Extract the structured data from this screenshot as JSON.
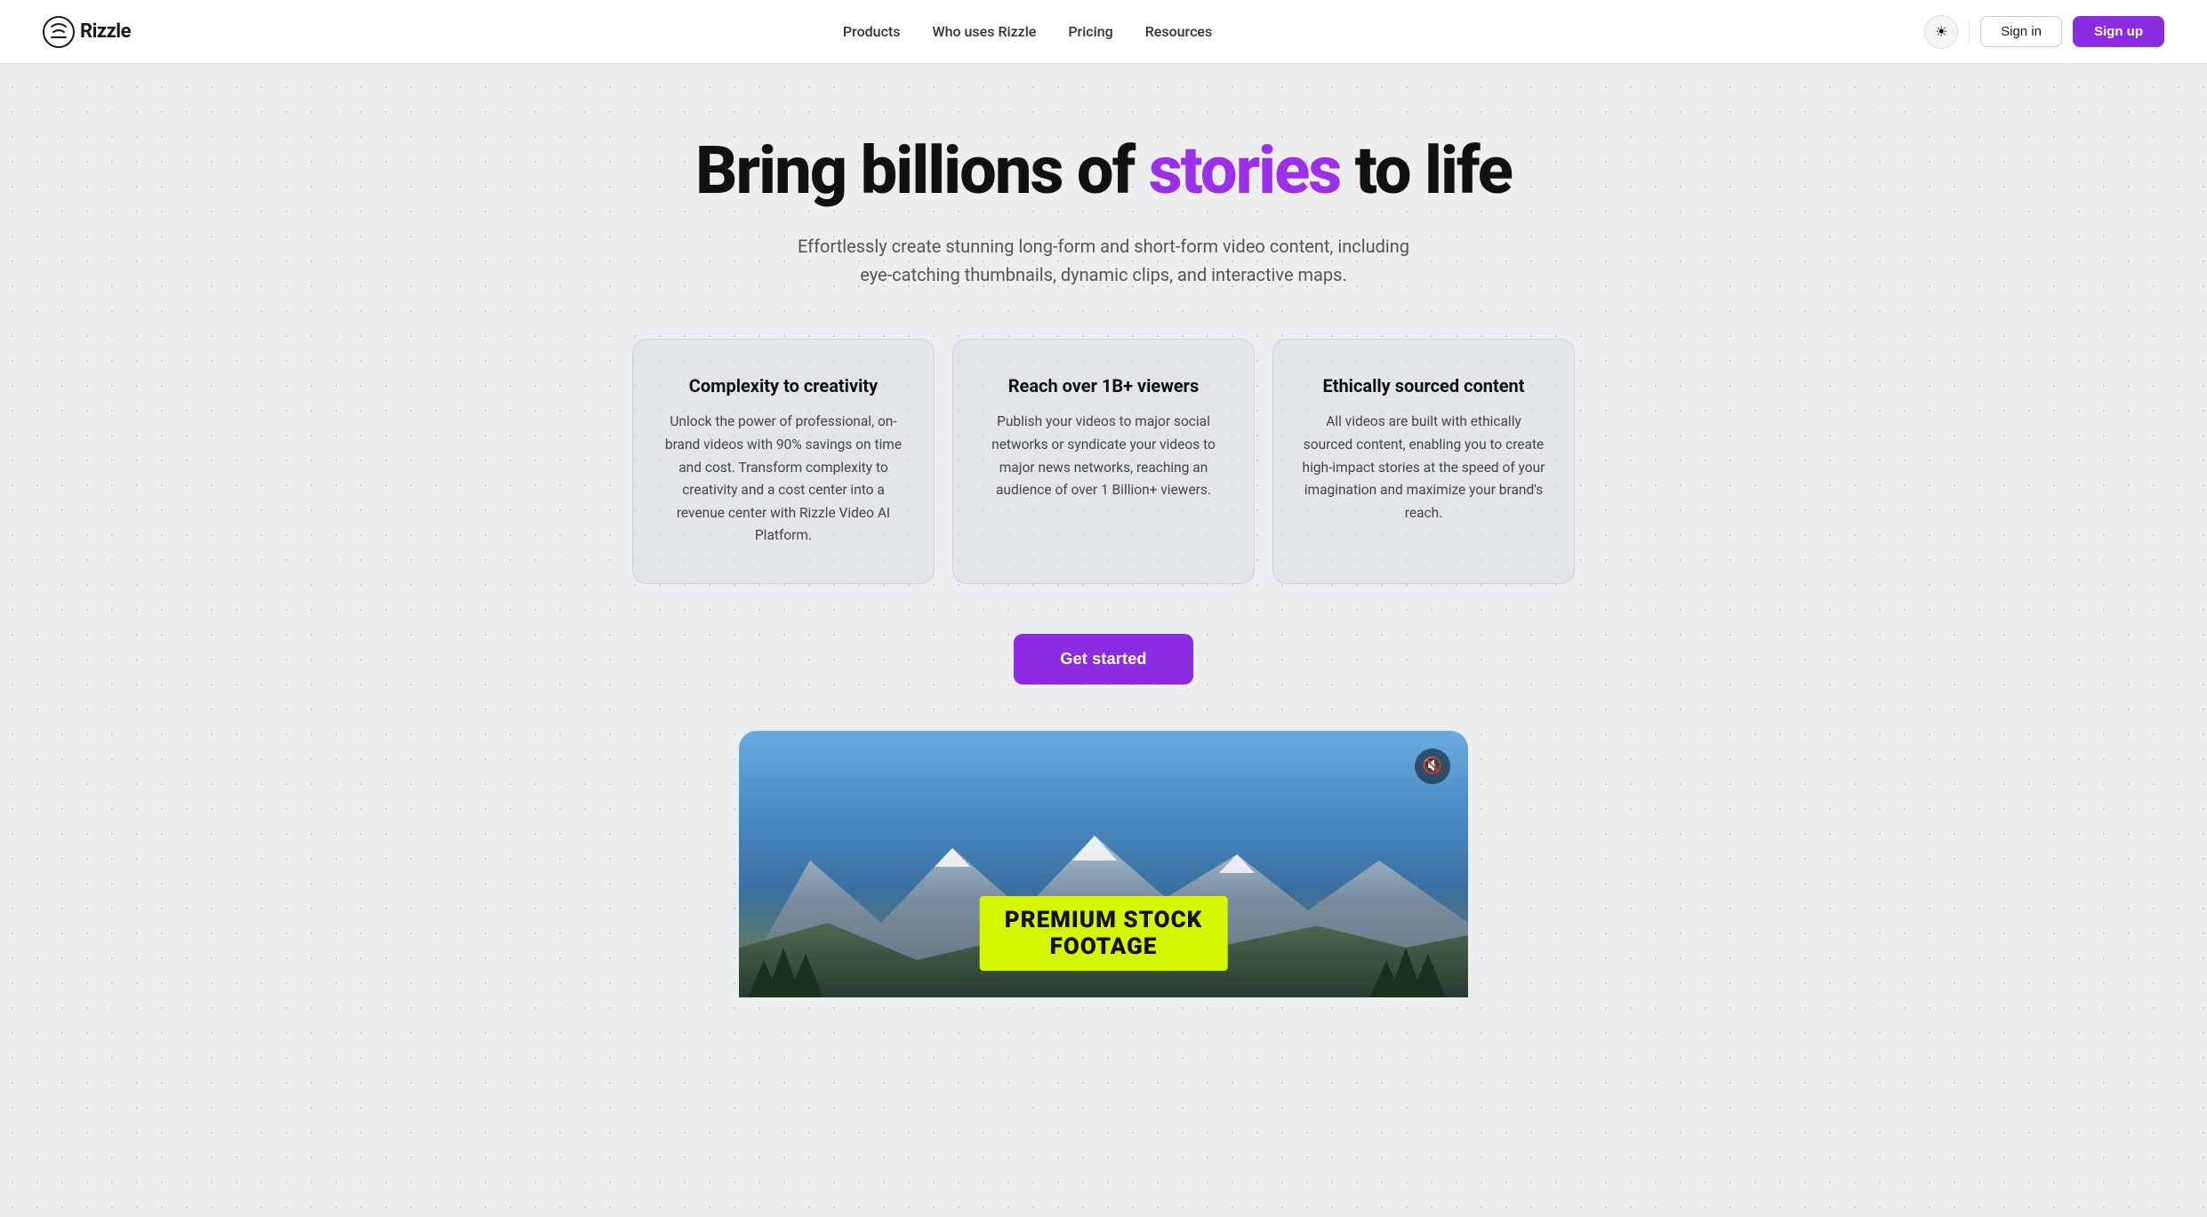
{
  "nav": {
    "logo_text": "Rizzle",
    "links": [
      {
        "id": "products",
        "label": "Products"
      },
      {
        "id": "who-uses",
        "label": "Who uses Rizzle"
      },
      {
        "id": "pricing",
        "label": "Pricing"
      },
      {
        "id": "resources",
        "label": "Resources"
      }
    ],
    "signin_label": "Sign in",
    "signup_label": "Sign up",
    "theme_icon": "☀"
  },
  "hero": {
    "title_prefix": "Bring billions of ",
    "title_highlight": "stories",
    "title_suffix": " to life",
    "subtitle": "Effortlessly create stunning long-form and short-form video content, including eye-catching thumbnails, dynamic clips, and interactive maps."
  },
  "cards": [
    {
      "id": "card-1",
      "title": "Complexity to creativity",
      "body": "Unlock the power of professional, on-brand videos with 90% savings on time and cost. Transform complexity to creativity and a cost center into a revenue center with Rizzle Video AI Platform."
    },
    {
      "id": "card-2",
      "title": "Reach over 1B+ viewers",
      "body": "Publish your videos to major social networks or syndicate your videos to major news networks, reaching an audience of over 1 Billion+ viewers."
    },
    {
      "id": "card-3",
      "title": "Ethically sourced content",
      "body": "All videos are built with ethically sourced content, enabling you to create high-impact stories at the speed of your imagination and maximize your brand's reach."
    }
  ],
  "cta": {
    "label": "Get started"
  },
  "video": {
    "label_line1": "PREMIUM STOCK",
    "label_line2": "FOOTAGE",
    "mute_icon": "🔇"
  }
}
